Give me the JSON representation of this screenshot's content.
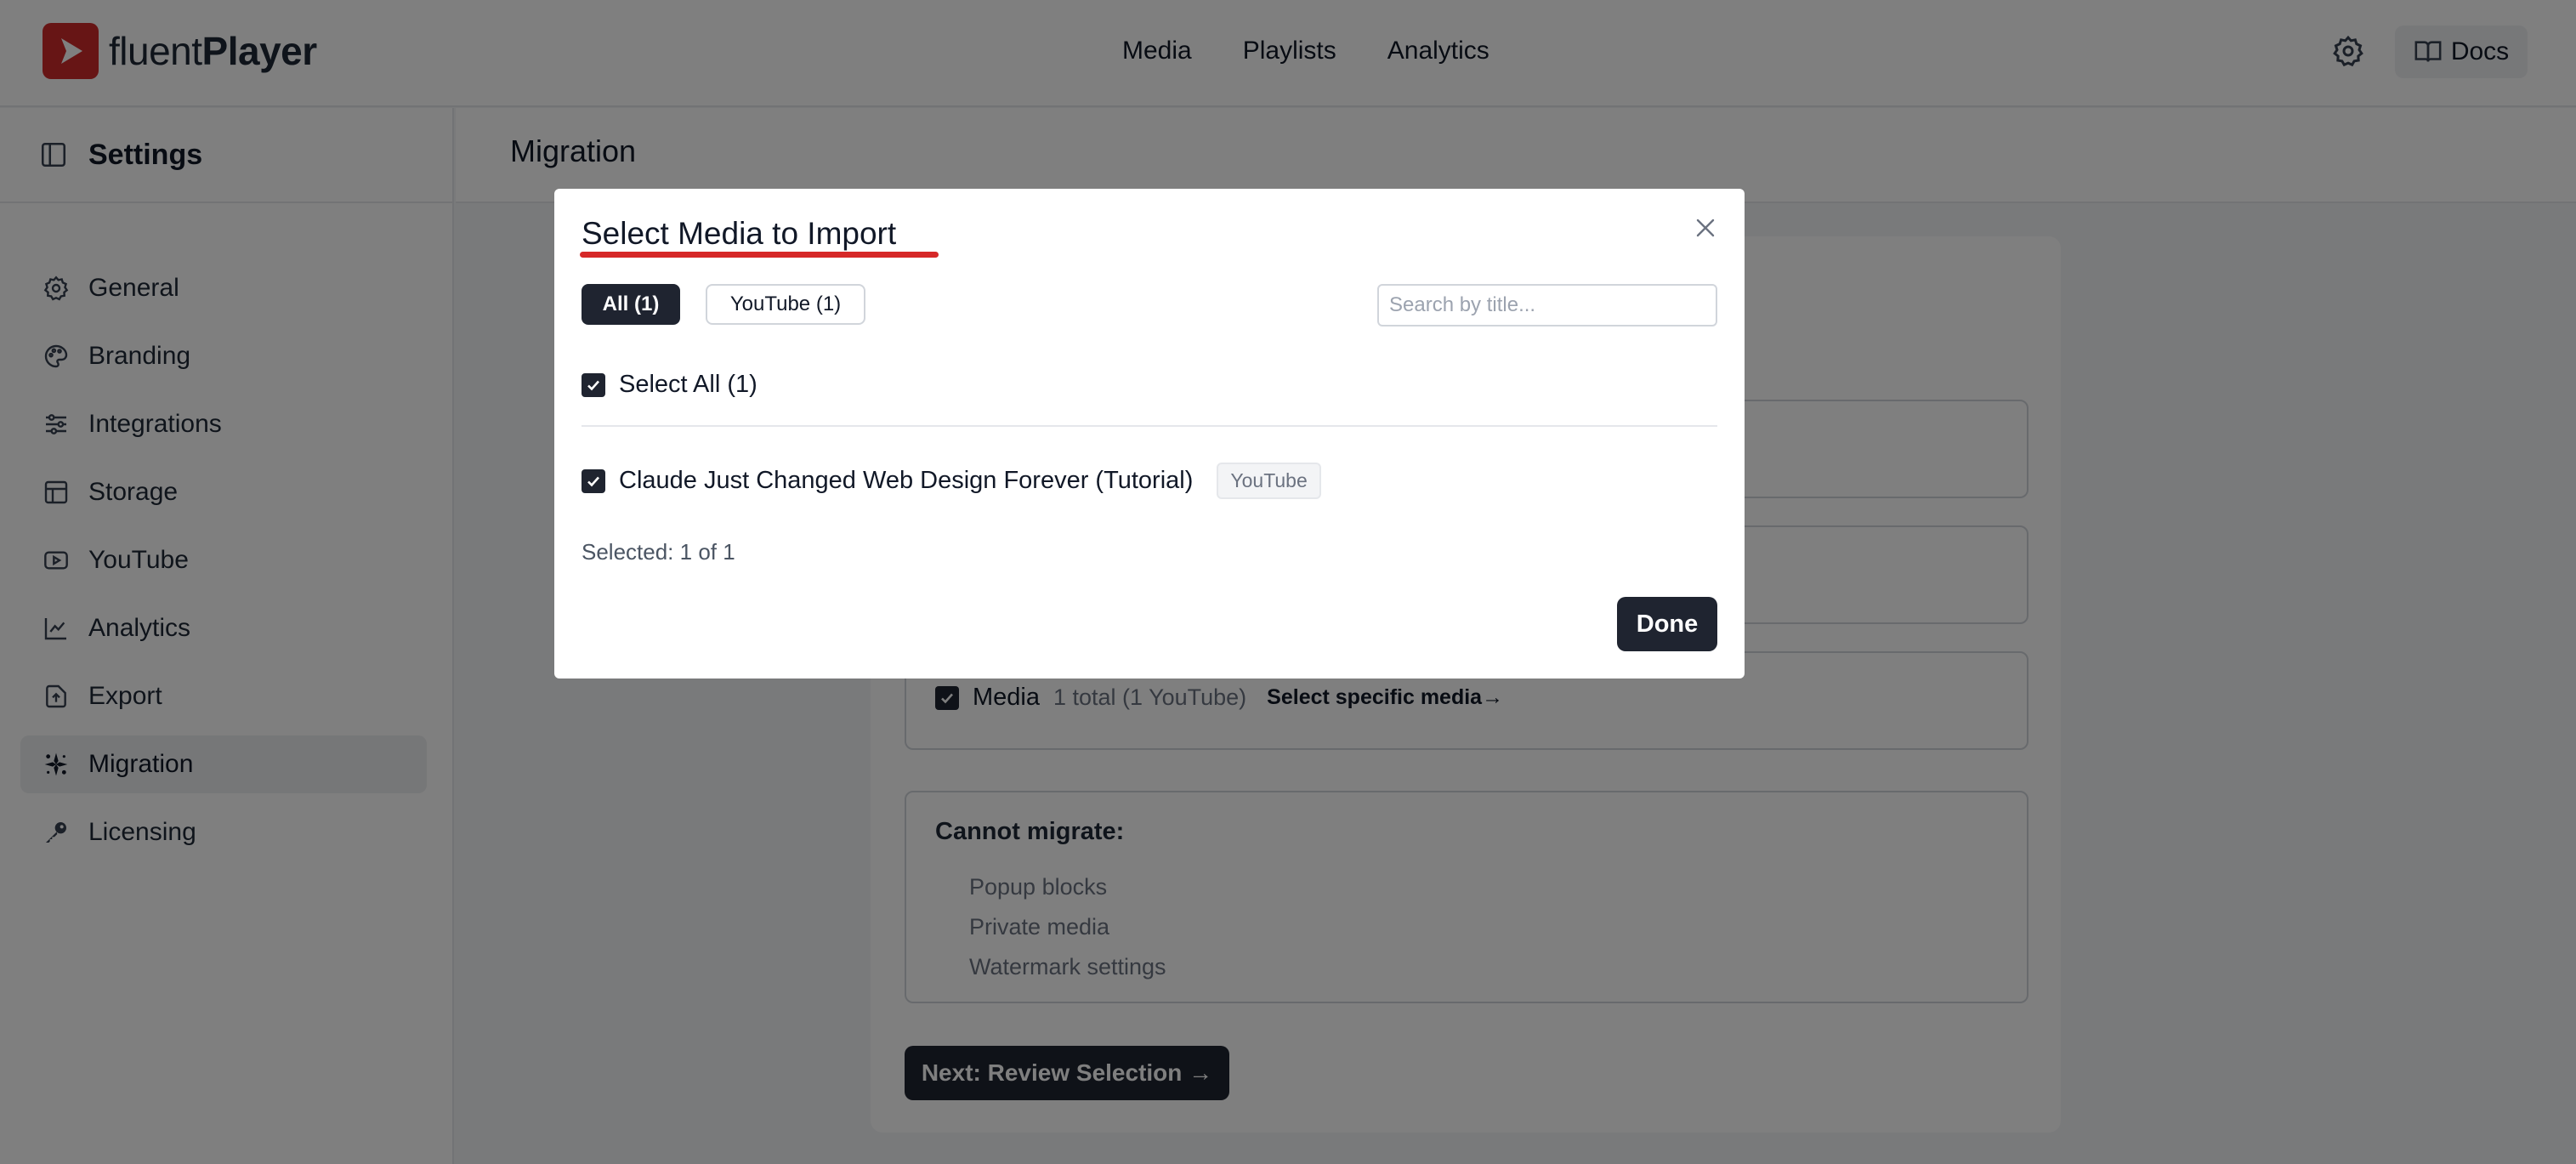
{
  "app": {
    "logo_regular": "fluent",
    "logo_bold": "Player",
    "nav": [
      "Media",
      "Playlists",
      "Analytics"
    ],
    "docs_label": "Docs",
    "brand_color": "#ce2a2a"
  },
  "sidebar": {
    "title": "Settings",
    "items": [
      {
        "label": "General",
        "icon": "gear-icon"
      },
      {
        "label": "Branding",
        "icon": "palette-icon"
      },
      {
        "label": "Integrations",
        "icon": "sliders-icon"
      },
      {
        "label": "Storage",
        "icon": "storage-icon"
      },
      {
        "label": "YouTube",
        "icon": "youtube-icon"
      },
      {
        "label": "Analytics",
        "icon": "chart-icon"
      },
      {
        "label": "Export",
        "icon": "export-icon"
      },
      {
        "label": "Migration",
        "icon": "migration-icon",
        "active": true
      },
      {
        "label": "Licensing",
        "icon": "key-icon"
      }
    ]
  },
  "main": {
    "title": "Migration",
    "media_option": {
      "label": "Media",
      "meta": "1 total (1 YouTube)",
      "link": "Select specific media→",
      "checked": true
    },
    "cannot_migrate": {
      "heading": "Cannot migrate:",
      "items": [
        "Popup blocks",
        "Private media",
        "Watermark settings"
      ]
    },
    "next_button": "Next: Review Selection →"
  },
  "modal": {
    "title": "Select Media to Import",
    "tabs": [
      {
        "label": "All (1)",
        "active": true
      },
      {
        "label": "YouTube (1)",
        "active": false
      }
    ],
    "search_placeholder": "Search by title...",
    "select_all": {
      "label": "Select All (1)",
      "checked": true
    },
    "items": [
      {
        "title": "Claude Just Changed Web Design Forever (Tutorial)",
        "source": "YouTube",
        "checked": true
      }
    ],
    "selected_text": "Selected: 1 of 1",
    "done_label": "Done"
  }
}
